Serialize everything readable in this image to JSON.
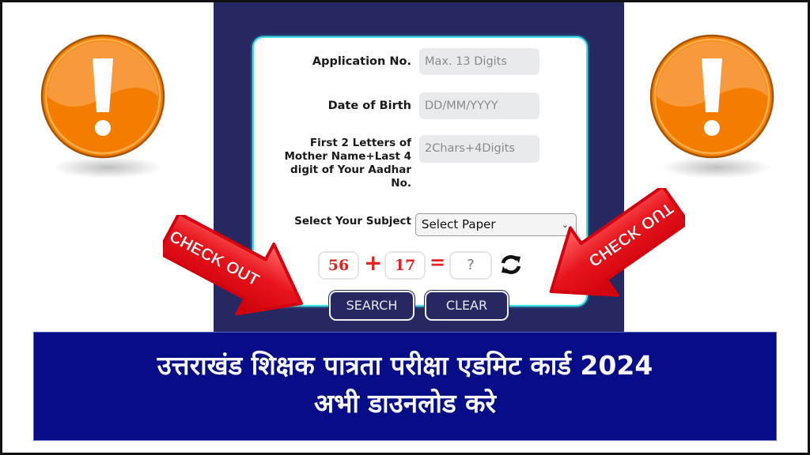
{
  "form": {
    "application_no": {
      "label": "Application No.",
      "placeholder": "Max. 13 Digits"
    },
    "dob": {
      "label": "Date of Birth",
      "placeholder": "DD/MM/YYYY"
    },
    "mother_aadhar": {
      "label_lines": [
        "First 2 Letters of",
        "Mother Name+Last 4",
        "digit of Your Aadhar",
        "No."
      ],
      "placeholder": "2Chars+4Digits"
    },
    "subject": {
      "label": "Select Your Subject",
      "selected": "Select Paper"
    },
    "captcha": {
      "a": "56",
      "op": "+",
      "b": "17",
      "eq": "=",
      "answer_placeholder": "?"
    },
    "buttons": {
      "search": "SEARCH",
      "clear": "CLEAR"
    }
  },
  "annotations": {
    "left_arrow_text": "CHECK OUT",
    "right_arrow_text": "CHECK OUT"
  },
  "banner": {
    "line1": "उत्तराखंड शिक्षक पात्रता परीक्षा एडमिट कार्ड 2024",
    "line2": "अभी डाउनलोड करे"
  },
  "colors": {
    "panel": "#272862",
    "card_border": "#3ee3ea",
    "banner": "#060d86",
    "captcha_red": "#e8201e",
    "warning_orange": "#f57c00",
    "arrow_red": "#e8141c"
  }
}
